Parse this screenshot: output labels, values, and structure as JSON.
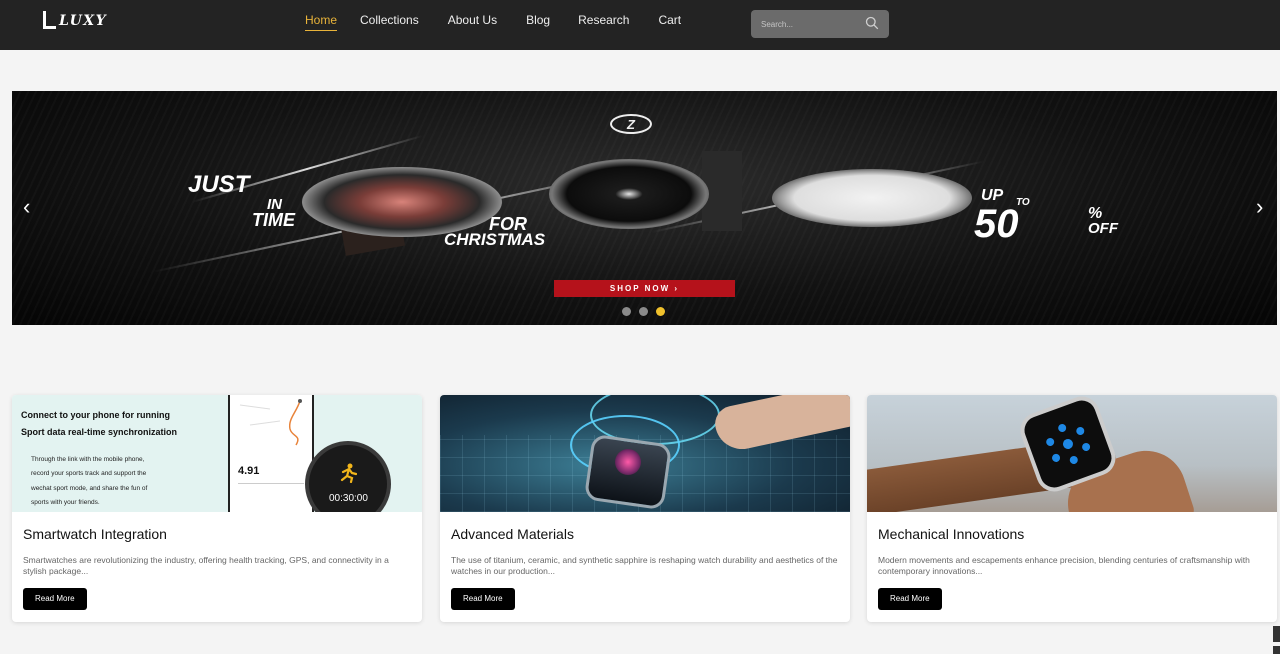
{
  "header": {
    "logo_text": "LUXY",
    "nav": [
      "Home",
      "Collections",
      "About Us",
      "Blog",
      "Research",
      "Cart"
    ],
    "active_nav": "Home",
    "search_placeholder": "Search..."
  },
  "banner": {
    "brand_mark": "Z",
    "headline_1": "JUST",
    "headline_2": "IN",
    "headline_3": "TIME",
    "headline_4": "FOR",
    "headline_5": "CHRISTMAS",
    "offer_1": "UP",
    "offer_2": "TO",
    "offer_3": "50",
    "offer_4": "%",
    "offer_5": "OFF",
    "cta": "SHOP NOW ›",
    "prev_arrow": "‹",
    "next_arrow": "›",
    "slides": 3,
    "active_slide": 3
  },
  "cards": [
    {
      "title": "Smartwatch Integration",
      "description": "Smartwatches are revolutionizing the industry, offering health tracking, GPS, and connectivity in a stylish package...",
      "button": "Read More",
      "image_text": {
        "head_1": "Connect to your phone for running",
        "head_2": "Sport data real-time synchronization",
        "body_1": "Through the link with the mobile phone,",
        "body_2": "record your sports track and support the",
        "body_3": "wechat sport mode, and share the fun of",
        "body_4": "sports with your friends.",
        "stat": "4.91",
        "timer": "00:30:00"
      }
    },
    {
      "title": "Advanced Materials",
      "description": "The use of titanium, ceramic, and synthetic sapphire is reshaping watch durability and aesthetics of the watches in our production...",
      "button": "Read More"
    },
    {
      "title": "Mechanical Innovations",
      "description": "Modern movements and escapements enhance precision, blending centuries of craftsmanship with contemporary innovations...",
      "button": "Read More"
    }
  ],
  "colors": {
    "header_bg": "#232323",
    "accent": "#e8b33a",
    "cta_red": "#b5121b",
    "active_dot": "#f0c12c"
  }
}
